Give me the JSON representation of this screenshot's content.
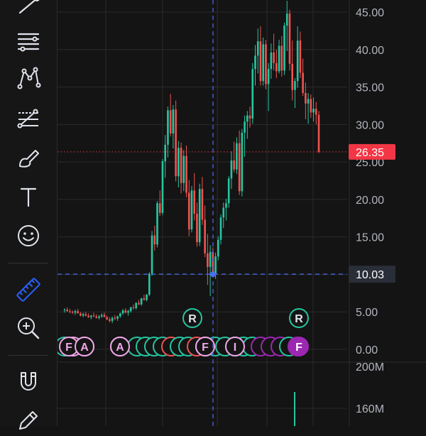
{
  "toolbar": {
    "tools": [
      {
        "id": "trend-line-tool",
        "icon": "trend-line-icon"
      },
      {
        "id": "horizontal-lines-tool",
        "icon": "horizontal-lines-icon"
      },
      {
        "id": "pattern-tool",
        "icon": "pattern-icon"
      },
      {
        "id": "forecast-tool",
        "icon": "forecast-icon"
      },
      {
        "id": "brush-tool",
        "icon": "brush-icon"
      },
      {
        "id": "text-tool",
        "icon": "text-icon",
        "glyph": "T"
      },
      {
        "id": "emoji-tool",
        "icon": "smiley-icon"
      },
      {
        "id": "measure-tool",
        "icon": "ruler-icon",
        "active": true
      },
      {
        "id": "zoom-tool",
        "icon": "zoom-in-icon"
      },
      {
        "id": "magnet-tool",
        "icon": "magnet-icon"
      },
      {
        "id": "pencil-tool",
        "icon": "pencil-icon"
      }
    ]
  },
  "colors": {
    "up": "#26c6a0",
    "down": "#ef5350",
    "active_tool": "#2962ff",
    "crosshair": "#4a6cf7",
    "last_price_bg": "#f23645",
    "crosshair_label_bg": "#2a2e39",
    "dividend_marker": "#f0a6e8",
    "earnings_marker": "#9c27b0"
  },
  "price_axis": {
    "ticks": [
      "45.00",
      "40.00",
      "35.00",
      "30.00",
      "25.00",
      "20.00",
      "15.00",
      "10.00",
      "5.00",
      "0.00"
    ],
    "last_price": "26.35",
    "crosshair_price": "10.03"
  },
  "volume_axis": {
    "ticks": [
      "200M",
      "160M"
    ]
  },
  "markers": {
    "upper": [
      "R",
      "R"
    ],
    "lower_letters": [
      "F",
      "A",
      "A",
      "F",
      "I",
      "F"
    ]
  },
  "chart_data": {
    "type": "candlestick",
    "ylim": [
      -1.5,
      47
    ],
    "y_ticks": [
      0,
      5,
      10,
      15,
      20,
      25,
      30,
      35,
      40,
      45
    ],
    "last_price": 26.35,
    "crosshair_price": 10.03,
    "candles": [
      [
        5.2,
        5.5,
        4.9,
        5.3
      ],
      [
        5.3,
        5.6,
        5.0,
        5.1
      ],
      [
        5.1,
        5.4,
        4.8,
        5.0
      ],
      [
        5.0,
        5.2,
        4.7,
        4.9
      ],
      [
        4.9,
        5.3,
        4.6,
        5.1
      ],
      [
        5.1,
        5.4,
        4.8,
        4.8
      ],
      [
        4.8,
        5.0,
        4.4,
        4.5
      ],
      [
        4.5,
        4.9,
        4.3,
        4.7
      ],
      [
        4.7,
        5.0,
        4.4,
        4.5
      ],
      [
        4.5,
        4.8,
        4.2,
        4.3
      ],
      [
        4.3,
        4.6,
        4.0,
        4.5
      ],
      [
        4.5,
        4.9,
        4.3,
        4.4
      ],
      [
        4.4,
        4.7,
        4.1,
        4.2
      ],
      [
        4.2,
        4.6,
        4.0,
        4.4
      ],
      [
        4.4,
        4.8,
        4.2,
        4.6
      ],
      [
        4.6,
        4.9,
        4.3,
        4.3
      ],
      [
        4.3,
        4.5,
        3.9,
        4.0
      ],
      [
        4.0,
        4.3,
        3.6,
        3.8
      ],
      [
        3.8,
        4.4,
        3.5,
        4.2
      ],
      [
        4.2,
        4.6,
        3.9,
        4.1
      ],
      [
        4.1,
        4.5,
        3.8,
        4.4
      ],
      [
        4.4,
        4.9,
        4.2,
        4.8
      ],
      [
        4.8,
        5.4,
        4.6,
        5.2
      ],
      [
        5.2,
        5.5,
        4.8,
        4.9
      ],
      [
        4.9,
        5.3,
        4.5,
        5.1
      ],
      [
        5.1,
        5.7,
        4.9,
        5.6
      ],
      [
        5.6,
        6.0,
        5.3,
        5.5
      ],
      [
        5.5,
        6.3,
        5.3,
        6.2
      ],
      [
        6.2,
        6.6,
        5.9,
        6.0
      ],
      [
        6.0,
        6.9,
        5.8,
        6.8
      ],
      [
        6.8,
        7.3,
        6.5,
        6.6
      ],
      [
        6.6,
        7.4,
        6.4,
        7.3
      ],
      [
        7.3,
        10.3,
        7.1,
        10.1
      ],
      [
        10.1,
        15.8,
        9.8,
        15.2
      ],
      [
        15.2,
        16.5,
        13.2,
        14.0
      ],
      [
        14.0,
        19.8,
        13.6,
        19.5
      ],
      [
        19.5,
        21.2,
        17.8,
        18.2
      ],
      [
        18.2,
        25.4,
        17.9,
        25.1
      ],
      [
        25.1,
        28.6,
        22.9,
        27.3
      ],
      [
        27.3,
        32.4,
        25.6,
        31.9
      ],
      [
        31.9,
        34.1,
        28.4,
        28.8
      ],
      [
        28.8,
        32.6,
        26.8,
        32.0
      ],
      [
        32.0,
        33.2,
        22.4,
        23.1
      ],
      [
        23.1,
        27.8,
        21.6,
        26.9
      ],
      [
        26.9,
        27.6,
        20.8,
        22.2
      ],
      [
        22.2,
        26.6,
        21.1,
        25.8
      ],
      [
        25.8,
        27.2,
        20.3,
        20.9
      ],
      [
        20.9,
        22.6,
        15.1,
        16.0
      ],
      [
        16.0,
        21.8,
        15.6,
        21.2
      ],
      [
        21.2,
        23.5,
        17.2,
        18.1
      ],
      [
        18.1,
        19.6,
        13.7,
        14.3
      ],
      [
        14.3,
        22.1,
        13.8,
        21.4
      ],
      [
        21.4,
        23.0,
        16.6,
        17.3
      ],
      [
        17.3,
        19.2,
        12.3,
        12.8
      ],
      [
        12.8,
        15.4,
        8.6,
        11.0
      ],
      [
        11.0,
        13.9,
        7.1,
        13.0
      ],
      [
        13.0,
        13.6,
        9.6,
        10.1
      ],
      [
        10.1,
        12.9,
        9.4,
        12.4
      ],
      [
        12.4,
        15.1,
        11.9,
        14.6
      ],
      [
        14.6,
        18.0,
        14.0,
        17.6
      ],
      [
        17.6,
        19.6,
        16.2,
        18.9
      ],
      [
        18.9,
        20.1,
        17.2,
        19.5
      ],
      [
        19.5,
        23.1,
        18.9,
        22.8
      ],
      [
        22.8,
        26.4,
        21.4,
        25.2
      ],
      [
        25.2,
        27.7,
        23.6,
        24.0
      ],
      [
        24.0,
        28.3,
        23.4,
        27.5
      ],
      [
        27.5,
        29.2,
        20.6,
        21.1
      ],
      [
        21.1,
        29.4,
        20.4,
        28.9
      ],
      [
        28.9,
        31.2,
        25.7,
        30.4
      ],
      [
        30.4,
        31.8,
        28.1,
        31.2
      ],
      [
        31.2,
        32.4,
        29.6,
        30.8
      ],
      [
        30.8,
        38.2,
        30.1,
        37.4
      ],
      [
        37.4,
        40.6,
        35.2,
        39.2
      ],
      [
        39.2,
        42.8,
        36.8,
        41.1
      ],
      [
        41.1,
        43.1,
        35.2,
        35.8
      ],
      [
        35.8,
        41.6,
        35.2,
        40.7
      ],
      [
        40.7,
        41.3,
        34.7,
        35.4
      ],
      [
        35.4,
        38.2,
        31.8,
        37.4
      ],
      [
        37.4,
        40.8,
        36.1,
        39.6
      ],
      [
        39.6,
        42.1,
        37.2,
        38.2
      ],
      [
        38.2,
        40.0,
        36.2,
        37.1
      ],
      [
        37.1,
        41.3,
        36.8,
        40.5
      ],
      [
        40.5,
        41.8,
        36.4,
        37.2
      ],
      [
        37.2,
        43.6,
        36.6,
        43.2
      ],
      [
        43.2,
        46.5,
        39.8,
        44.8
      ],
      [
        44.8,
        45.3,
        37.2,
        38.1
      ],
      [
        38.1,
        41.2,
        33.2,
        34.6
      ],
      [
        34.6,
        36.2,
        32.2,
        35.8
      ],
      [
        35.8,
        43.1,
        34.9,
        41.2
      ],
      [
        41.2,
        42.4,
        36.2,
        36.9
      ],
      [
        36.9,
        38.8,
        33.8,
        34.2
      ],
      [
        34.2,
        35.6,
        30.7,
        32.8
      ],
      [
        32.8,
        34.2,
        30.1,
        33.4
      ],
      [
        33.4,
        34.0,
        30.9,
        31.6
      ],
      [
        31.6,
        33.6,
        30.4,
        32.1
      ],
      [
        32.1,
        33.0,
        30.0,
        31.3
      ],
      [
        31.3,
        31.8,
        26.2,
        26.35
      ]
    ]
  }
}
